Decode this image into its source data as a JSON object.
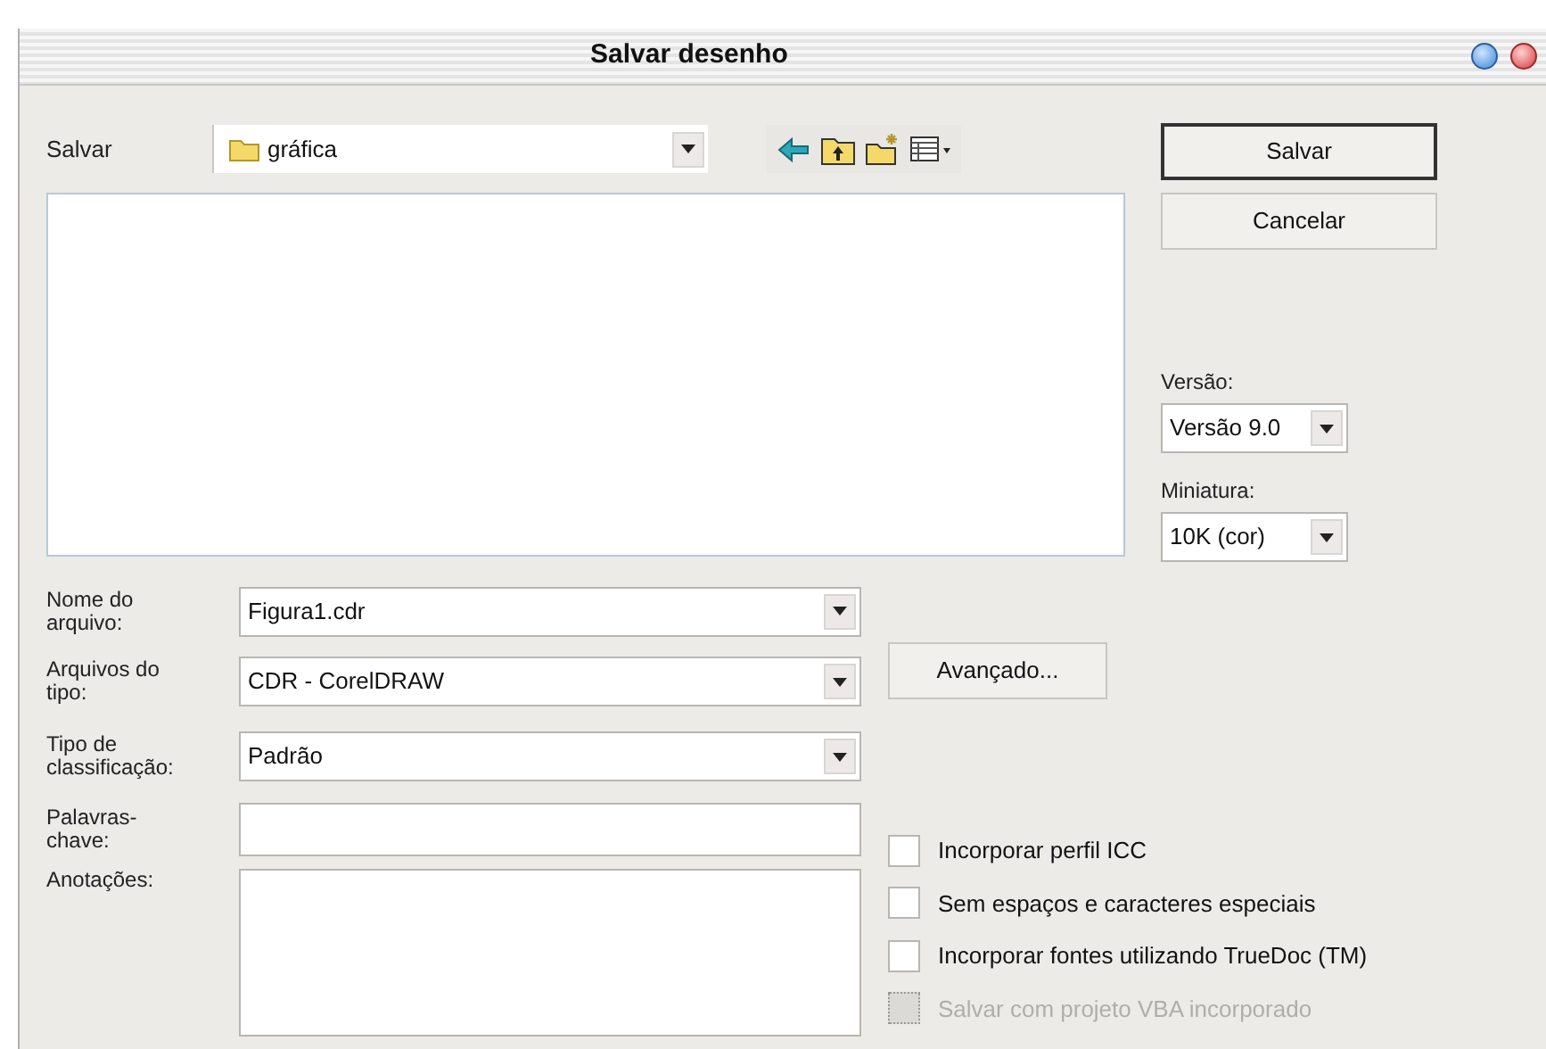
{
  "window": {
    "title": "Salvar desenho"
  },
  "save_in": {
    "label": "Salvar",
    "value": "gráfica"
  },
  "buttons": [
    {
      "label": "Salvar",
      "default": true
    },
    {
      "label": "Cancelar",
      "default": false
    }
  ],
  "version": {
    "label": "Versão:",
    "value": "Versão 9.0"
  },
  "thumbnail": {
    "label": "Miniatura:",
    "value": "10K (cor)"
  },
  "fields": [
    {
      "label": "Nome do arquivo:",
      "value": "Figura1.cdr",
      "kind": "combo"
    },
    {
      "label": "Arquivos do tipo:",
      "value": "CDR - CorelDRAW",
      "kind": "combo"
    },
    {
      "label": "Tipo de classificação:",
      "value": "Padrão",
      "kind": "combo"
    },
    {
      "label": "Palavras-chave:",
      "kind": "text"
    },
    {
      "label": "Anotações:",
      "kind": "area"
    }
  ],
  "advanced_button": "Avançado...",
  "options": [
    {
      "label": "Incorporar perfil ICC",
      "checked": false,
      "disabled": false
    },
    {
      "label": "Sem espaços e caracteres especiais",
      "checked": false,
      "disabled": false
    },
    {
      "label": "Incorporar fontes utilizando TrueDoc (TM)",
      "checked": false,
      "disabled": false
    },
    {
      "label": "Salvar com projeto VBA incorporado",
      "checked": false,
      "disabled": true
    }
  ]
}
